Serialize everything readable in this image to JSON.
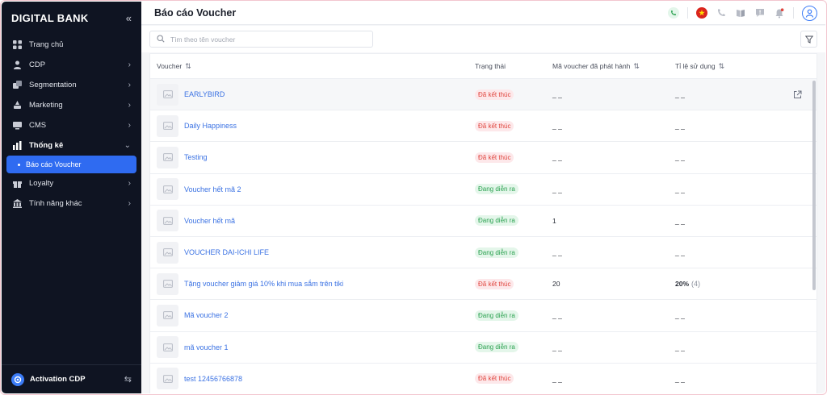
{
  "sidebar": {
    "brand": "DIGITAL BANK",
    "collapse_icon": "«",
    "items": [
      {
        "label": "Trang chủ",
        "icon": "grid-icon",
        "has_chevron": false
      },
      {
        "label": "CDP",
        "icon": "user-icon",
        "has_chevron": true
      },
      {
        "label": "Segmentation",
        "icon": "layers-icon",
        "has_chevron": true
      },
      {
        "label": "Marketing",
        "icon": "megaphone-icon",
        "has_chevron": true
      },
      {
        "label": "CMS",
        "icon": "monitor-icon",
        "has_chevron": true
      },
      {
        "label": "Thống kê",
        "icon": "chart-icon",
        "has_chevron": true,
        "open": true
      },
      {
        "label": "Loyalty",
        "icon": "gift-icon",
        "has_chevron": true
      },
      {
        "label": "Tính năng khác",
        "icon": "bank-icon",
        "has_chevron": true
      }
    ],
    "active_sub_item": "Báo cáo Voucher",
    "footer_label": "Activation CDP"
  },
  "header": {
    "title": "Báo cáo Voucher"
  },
  "search": {
    "placeholder": "Tìm theo tên voucher",
    "value": ""
  },
  "table": {
    "columns": [
      "Voucher",
      "Trạng thái",
      "Mã voucher đã phát hành",
      "Tỉ lệ sử dụng"
    ],
    "rows": [
      {
        "name": "EARLYBIRD",
        "status": "Đã kết thúc",
        "status_type": "ended",
        "issued": "_ _",
        "usage": "_ _",
        "usage_count": ""
      },
      {
        "name": "Daily Happiness",
        "status": "Đã kết thúc",
        "status_type": "ended",
        "issued": "_ _",
        "usage": "_ _",
        "usage_count": ""
      },
      {
        "name": "Testing",
        "status": "Đã kết thúc",
        "status_type": "ended",
        "issued": "_ _",
        "usage": "_ _",
        "usage_count": ""
      },
      {
        "name": "Voucher hết mã 2",
        "status": "Đang diễn ra",
        "status_type": "running",
        "issued": "_ _",
        "usage": "_ _",
        "usage_count": ""
      },
      {
        "name": "Voucher hết mã",
        "status": "Đang diễn ra",
        "status_type": "running",
        "issued": "1",
        "usage": "_ _",
        "usage_count": ""
      },
      {
        "name": "VOUCHER DAI-ICHI LIFE",
        "status": "Đang diễn ra",
        "status_type": "running",
        "issued": "_ _",
        "usage": "_ _",
        "usage_count": ""
      },
      {
        "name": "Tặng voucher giảm giá 10% khi mua sắm trên tiki",
        "status": "Đã kết thúc",
        "status_type": "ended",
        "issued": "20",
        "usage": "20%",
        "usage_count": "(4)"
      },
      {
        "name": "Mã voucher 2",
        "status": "Đang diễn ra",
        "status_type": "running",
        "issued": "_ _",
        "usage": "_ _",
        "usage_count": ""
      },
      {
        "name": "mã voucher 1",
        "status": "Đang diễn ra",
        "status_type": "running",
        "issued": "_ _",
        "usage": "_ _",
        "usage_count": ""
      },
      {
        "name": "test 12456766878",
        "status": "Đã kết thúc",
        "status_type": "ended",
        "issued": "_ _",
        "usage": "_ _",
        "usage_count": ""
      }
    ]
  },
  "colors": {
    "sidebar_bg": "#0f1422",
    "accent": "#2f6bf1",
    "link": "#3b72e3",
    "ended": "#e0463f",
    "running": "#2aa14f"
  }
}
